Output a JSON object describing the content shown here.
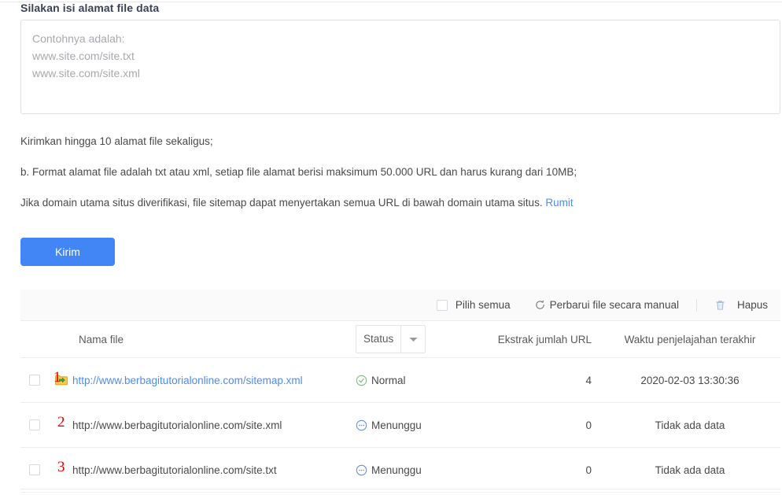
{
  "section": {
    "title": "Silakan isi alamat file data"
  },
  "textarea": {
    "name": "url-input",
    "value": "",
    "placeholder": "Contohnya adalah:\nwww.site.com/site.txt\nwww.site.com/site.xml"
  },
  "notes": [
    "Kirimkan hingga 10 alamat file sekaligus;",
    "b. Format alamat file adalah txt atau xml, setiap file alamat berisi maksimum 50.000 URL dan harus kurang dari 10MB;",
    "Jika domain utama situs diverifikasi, file sitemap dapat menyertakan semua URL di bawah domain utama situs. "
  ],
  "note_link": "Rumit",
  "submit": {
    "label": "Kirim"
  },
  "toolbar": {
    "select_all_label": "Pilih semua",
    "refresh_label": "Perbarui file secara manual",
    "refresh_icon": "refresh-icon",
    "delete_label": "Hapus",
    "delete_icon": "trash-icon"
  },
  "table": {
    "headers": {
      "name": "Nama file",
      "status": "Status",
      "count": "Ekstrak jumlah URL",
      "time": "Waktu penjelajahan terakhir"
    },
    "status_filter_icon": "chevron-down-icon",
    "rows": [
      {
        "num": "1",
        "file": "http://www.berbagitutorialonline.com/sitemap.xml",
        "is_link": true,
        "has_folder_icon": true,
        "folder_icon": "folder-export-icon",
        "status": "Normal",
        "status_icon": "check-circle-icon",
        "count": "4",
        "time": "2020-02-03 13:30:36"
      },
      {
        "num": "2",
        "file": "http://www.berbagitutorialonline.com/site.xml",
        "is_link": false,
        "has_folder_icon": false,
        "status": "Menunggu",
        "status_icon": "pending-circle-icon",
        "count": "0",
        "time": "Tidak ada data"
      },
      {
        "num": "3",
        "file": "http://www.berbagitutorialonline.com/site.txt",
        "is_link": false,
        "has_folder_icon": false,
        "status": "Menunggu",
        "status_icon": "pending-circle-icon",
        "count": "0",
        "time": "Tidak ada data"
      }
    ]
  },
  "colors": {
    "accent": "#4285f4",
    "link": "#4c8cf5",
    "annotation": "#e60000",
    "status_ok": "#6fbf73",
    "status_pending": "#5b8ddb",
    "folder": "#f1c232"
  }
}
